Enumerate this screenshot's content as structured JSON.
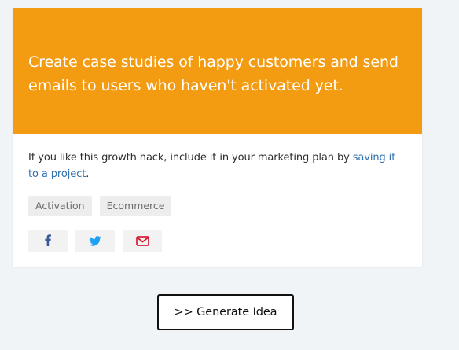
{
  "card": {
    "headline": "Create case studies of happy customers and send emails to users who haven't activated yet.",
    "description_prefix": "If you like this growth hack, include it in your marketing plan by ",
    "description_link": "saving it to a project",
    "description_suffix": ".",
    "tags": [
      "Activation",
      "Ecommerce"
    ],
    "share": [
      {
        "icon": "facebook-icon",
        "color": "#3b5998"
      },
      {
        "icon": "twitter-icon",
        "color": "#1da1f2"
      },
      {
        "icon": "email-icon",
        "color": "#d0021b"
      }
    ],
    "banner_color": "#f39c12"
  },
  "generate_button": {
    "label": ">> Generate Idea"
  }
}
